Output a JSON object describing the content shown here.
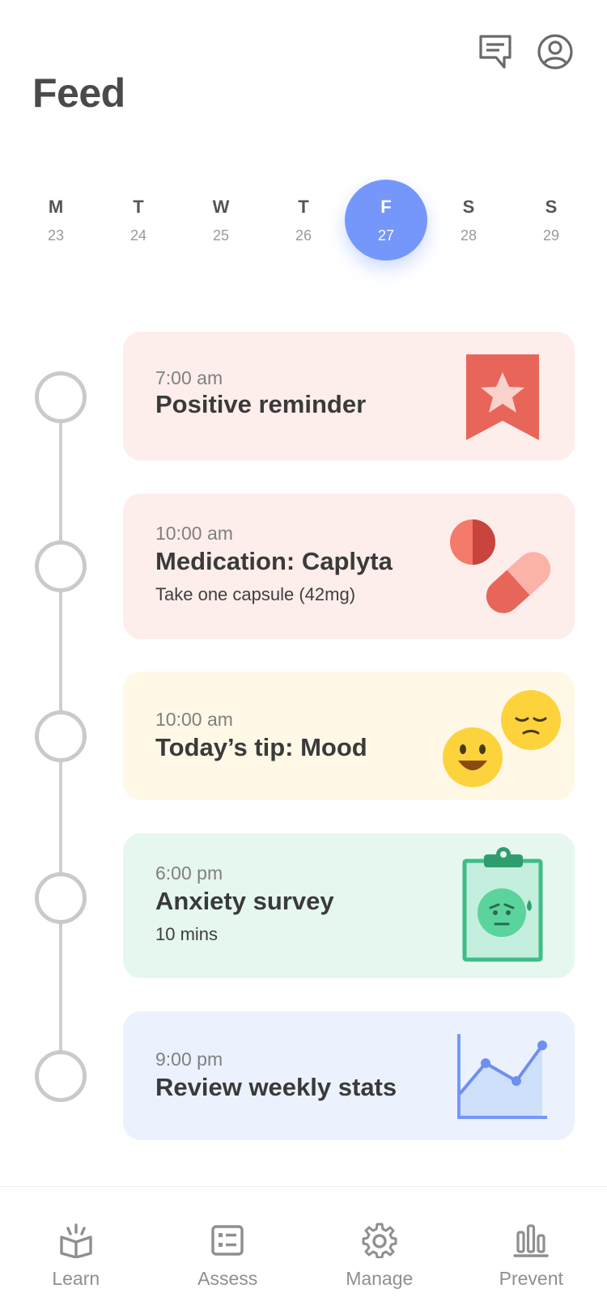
{
  "header": {
    "title": "Feed",
    "icons": [
      "chat-icon",
      "profile-icon"
    ]
  },
  "week": [
    {
      "day": "M",
      "date": "23",
      "selected": false
    },
    {
      "day": "T",
      "date": "24",
      "selected": false
    },
    {
      "day": "W",
      "date": "25",
      "selected": false
    },
    {
      "day": "T",
      "date": "26",
      "selected": false
    },
    {
      "day": "F",
      "date": "27",
      "selected": true
    },
    {
      "day": "S",
      "date": "28",
      "selected": false
    },
    {
      "day": "S",
      "date": "29",
      "selected": false
    }
  ],
  "feed": [
    {
      "time": "7:00 am",
      "title": "Positive reminder",
      "subtitle": "",
      "color": "#fdeeeb",
      "icon": "bookmark-star-icon"
    },
    {
      "time": "10:00 am",
      "title": "Medication: Caplyta",
      "subtitle": "Take one capsule (42mg)",
      "color": "#fdeeeb",
      "icon": "pills-icon"
    },
    {
      "time": "10:00 am",
      "title": "Today’s tip: Mood",
      "subtitle": "",
      "color": "#fff8e7",
      "icon": "mood-faces-icon"
    },
    {
      "time": "6:00 pm",
      "title": "Anxiety survey",
      "subtitle": "10 mins",
      "color": "#e6f7ef",
      "icon": "clipboard-anxious-face-icon"
    },
    {
      "time": "9:00 pm",
      "title": "Review weekly stats",
      "subtitle": "",
      "color": "#ebf2fd",
      "icon": "line-chart-icon"
    }
  ],
  "nav": [
    {
      "label": "Learn",
      "icon": "open-book-icon"
    },
    {
      "label": "Assess",
      "icon": "checklist-card-icon"
    },
    {
      "label": "Manage",
      "icon": "gear-icon"
    },
    {
      "label": "Prevent",
      "icon": "bar-chart-icon"
    }
  ],
  "colors": {
    "accent": "#7597fb",
    "timeline": "#cacaca",
    "nav_text": "#8f8f8f"
  }
}
